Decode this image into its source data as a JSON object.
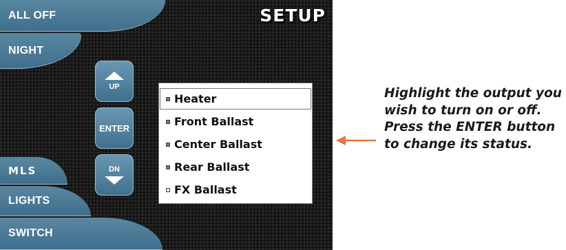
{
  "screen": {
    "title": "SETUP",
    "menu": {
      "all_off": "ALL OFF",
      "night": "NIGHT",
      "mls": "MLS",
      "lights": "LIGHTS",
      "switch": "SWITCH"
    },
    "controls": {
      "up_label": "UP",
      "enter_label": "ENTER",
      "down_label": "DN"
    },
    "outputs": [
      {
        "label": "Heater",
        "checked": true,
        "selected": true
      },
      {
        "label": "Front Ballast",
        "checked": true,
        "selected": false
      },
      {
        "label": "Center Ballast",
        "checked": true,
        "selected": false
      },
      {
        "label": "Rear Ballast",
        "checked": true,
        "selected": false
      },
      {
        "label": "FX Ballast",
        "checked": false,
        "selected": false
      }
    ]
  },
  "instruction": "Highlight  the output you wish to turn on or off.  Press the ENTER button to change its status.",
  "colors": {
    "button_fill": "#4a7a96",
    "arrow": "#e8743b"
  }
}
